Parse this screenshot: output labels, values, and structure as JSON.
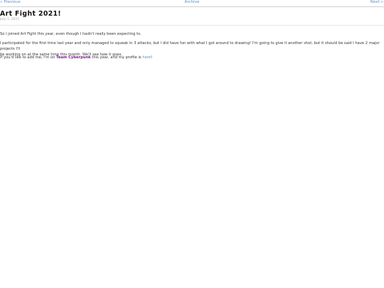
{
  "nav": {
    "previous": "« Previous",
    "archive": "Archive",
    "next": "Next »"
  },
  "post": {
    "title": "Art Fight 2021!",
    "date": "July 1, 2021",
    "paragraph1": "So I joined Art Fight this year, even though I hadn't really been expecting to.",
    "paragraph2_line1": "I participated for the first time last year and only managed to squeak in 3 attacks, but I did have fun with what I got around to drawing! I'm going to give it another shot, but it should be said I have 2 major projects I'll",
    "paragraph2_line2": "be working on at the same time this month. We'll see how it goes.",
    "paragraph3_pre": "If you'd like to add me, I'm on ",
    "team_name": "Team Cyberpunk",
    "paragraph3_mid": " this year, and my profile is ",
    "profile_link": "here",
    "paragraph3_post": "!"
  },
  "colors": {
    "link": "#5b8fc7",
    "team": "#7a1d8c"
  }
}
